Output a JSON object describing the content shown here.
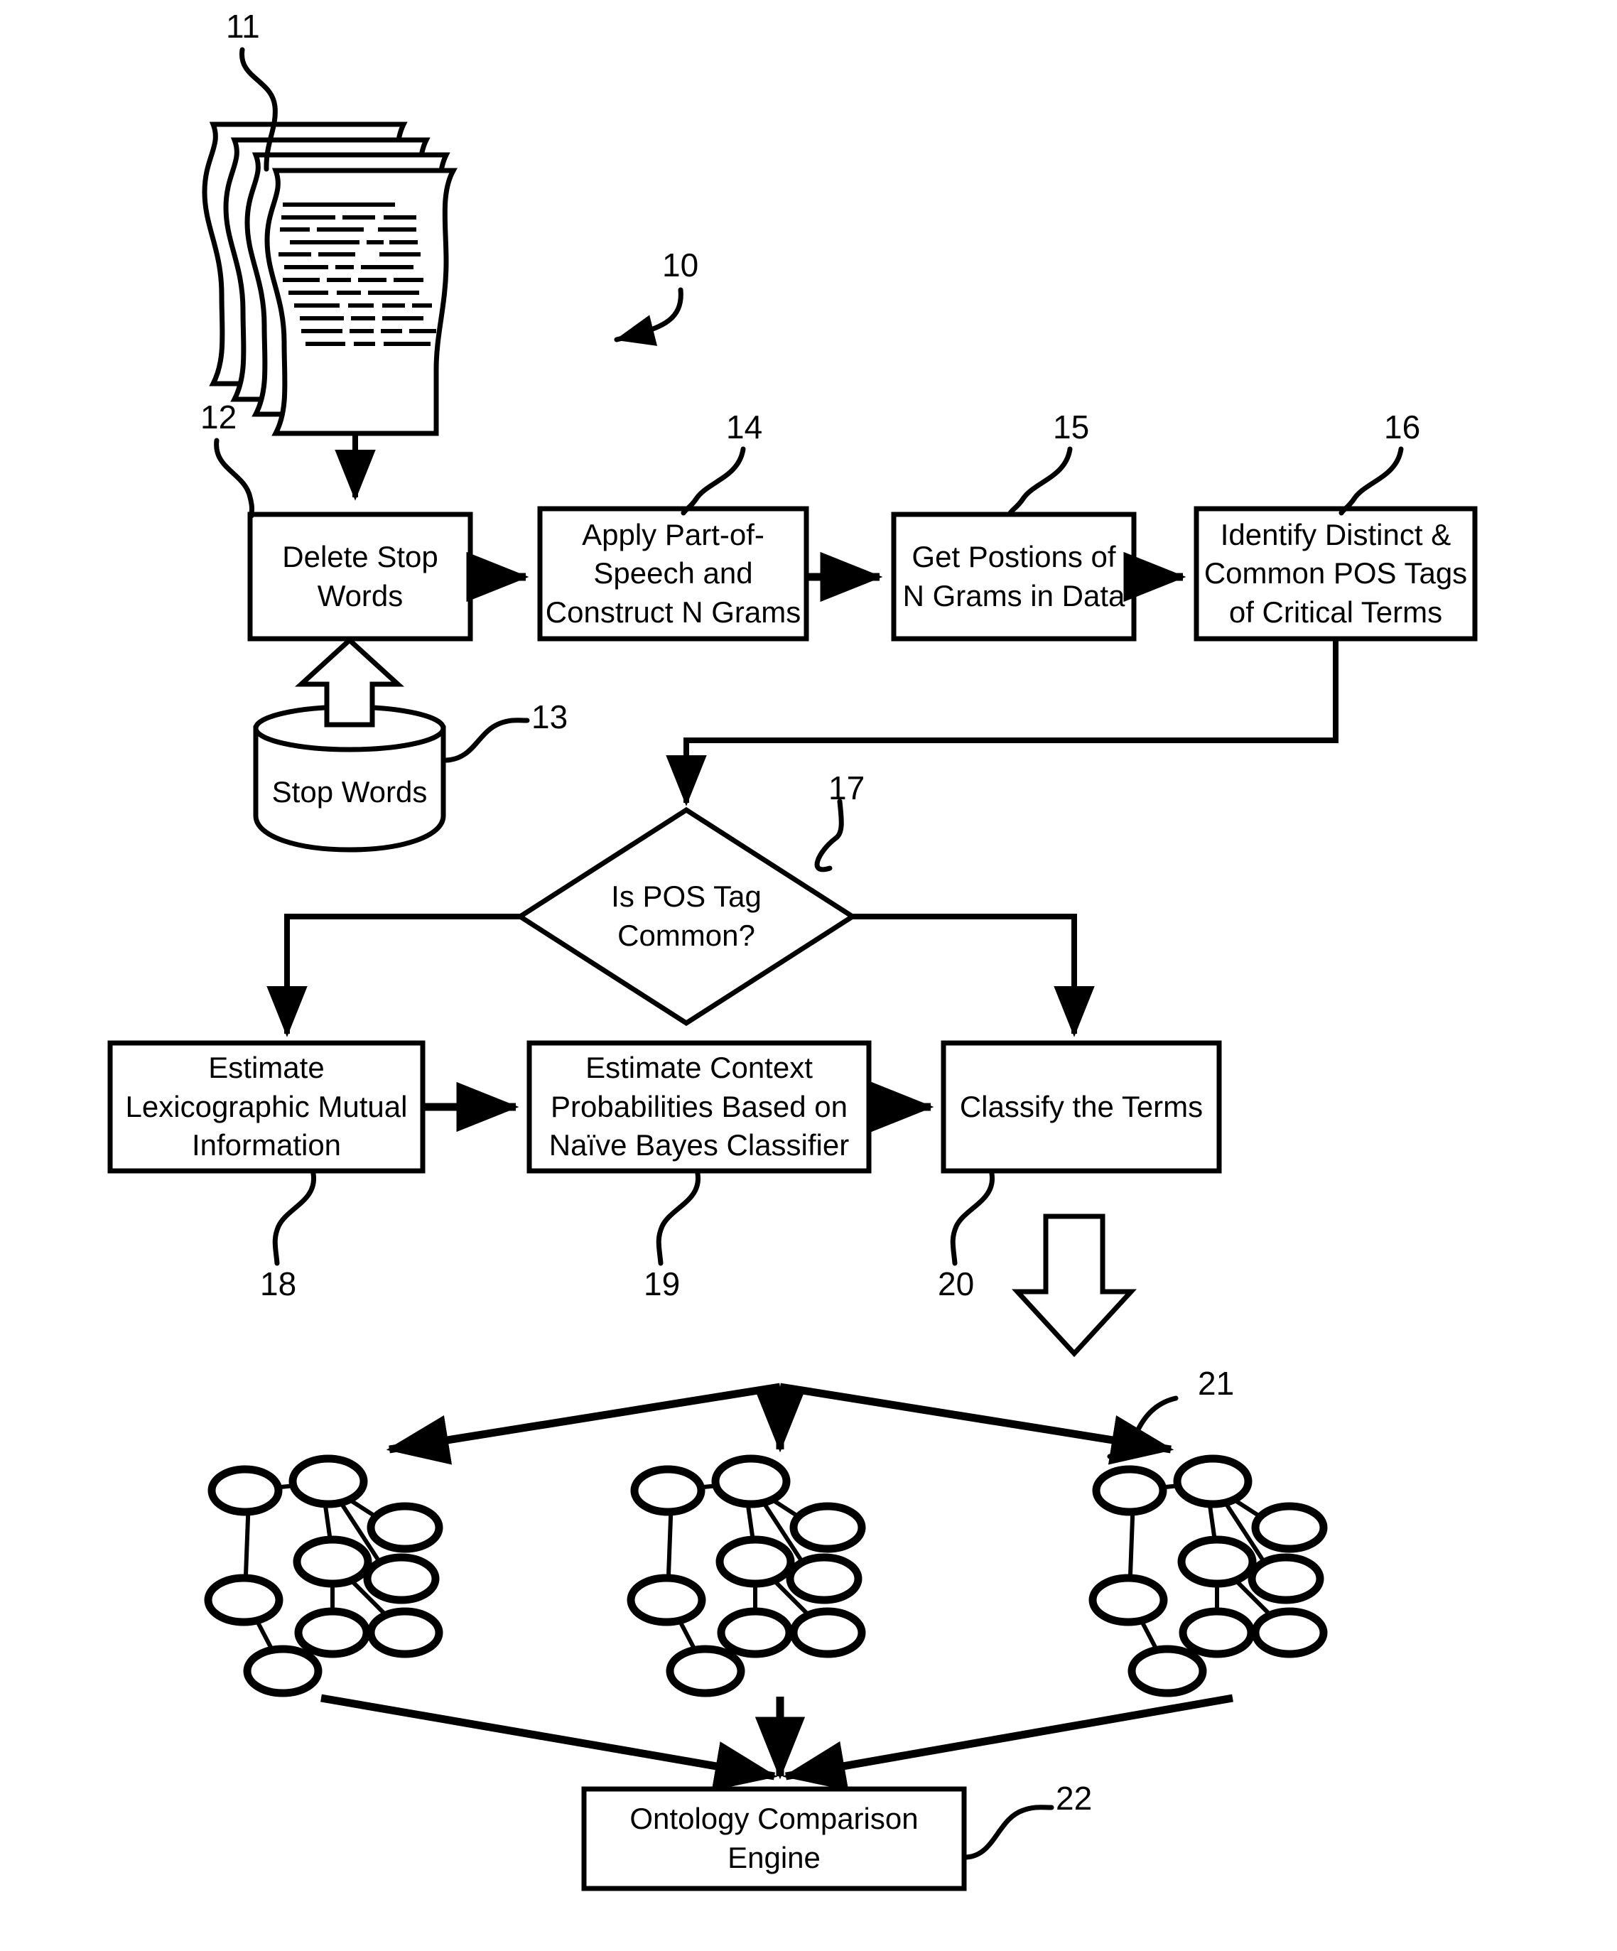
{
  "figure": {
    "type": "patent-flowchart",
    "title": "",
    "overall_reference": "10"
  },
  "reference_numerals": {
    "documents": "11",
    "delete_stop_words": "12",
    "stop_words_store": "13",
    "apply_pos": "14",
    "get_positions": "15",
    "identify_tags": "16",
    "decision": "17",
    "estimate_lmi": "18",
    "estimate_context": "19",
    "classify_terms": "20",
    "ontologies": "21",
    "comparison_engine": "22",
    "system": "10"
  },
  "nodes": {
    "documents": {
      "label": "",
      "kind": "document-stack",
      "ref": "11"
    },
    "delete_stop_words": {
      "line1": "Delete Stop",
      "line2": "Words",
      "kind": "process",
      "ref": "12"
    },
    "stop_words_store": {
      "label": "Stop Words",
      "kind": "database",
      "ref": "13"
    },
    "apply_pos": {
      "line1": "Apply Part-of-",
      "line2": "Speech and",
      "line3": "Construct N Grams",
      "kind": "process",
      "ref": "14"
    },
    "get_positions": {
      "line1": "Get Postions of",
      "line2": "N Grams in Data",
      "kind": "process",
      "ref": "15"
    },
    "identify_tags": {
      "line1": "Identify Distinct &",
      "line2": "Common POS Tags",
      "line3": "of Critical Terms",
      "kind": "process",
      "ref": "16"
    },
    "decision": {
      "line1": "Is POS Tag",
      "line2": "Common?",
      "kind": "decision",
      "ref": "17"
    },
    "estimate_lmi": {
      "line1": "Estimate",
      "line2": "Lexicographic Mutual",
      "line3": "Information",
      "kind": "process",
      "ref": "18"
    },
    "estimate_context": {
      "line1": "Estimate Context",
      "line2": "Probabilities Based on",
      "line3": "Naïve Bayes Classifier",
      "kind": "process",
      "ref": "19"
    },
    "classify_terms": {
      "line1": "Classify the Terms",
      "kind": "process",
      "ref": "20"
    },
    "ontologies": {
      "label": "",
      "kind": "ontology-graphs",
      "count": 3,
      "ref": "21"
    },
    "comparison_engine": {
      "line1": "Ontology Comparison",
      "line2": "Engine",
      "kind": "process",
      "ref": "22"
    }
  },
  "flow_edges": [
    {
      "from": "documents",
      "to": "delete_stop_words",
      "style": "arrow-down"
    },
    {
      "from": "stop_words_store",
      "to": "delete_stop_words",
      "style": "block-arrow-up"
    },
    {
      "from": "delete_stop_words",
      "to": "apply_pos",
      "style": "arrow-right"
    },
    {
      "from": "apply_pos",
      "to": "get_positions",
      "style": "arrow-right"
    },
    {
      "from": "get_positions",
      "to": "identify_tags",
      "style": "arrow-right"
    },
    {
      "from": "identify_tags",
      "to": "decision",
      "style": "elbow-down-left"
    },
    {
      "from": "decision",
      "to": "estimate_lmi",
      "style": "branch-left-down"
    },
    {
      "from": "decision",
      "to": "classify_terms",
      "style": "branch-right-down"
    },
    {
      "from": "estimate_lmi",
      "to": "estimate_context",
      "style": "arrow-right"
    },
    {
      "from": "estimate_context",
      "to": "classify_terms",
      "style": "arrow-right"
    },
    {
      "from": "classify_terms",
      "to": "ontologies",
      "style": "block-arrow-down"
    },
    {
      "from": "ontologies",
      "to": "comparison_engine",
      "style": "fan-in"
    }
  ],
  "colors": {
    "ink": "#000000",
    "paper": "#ffffff"
  }
}
